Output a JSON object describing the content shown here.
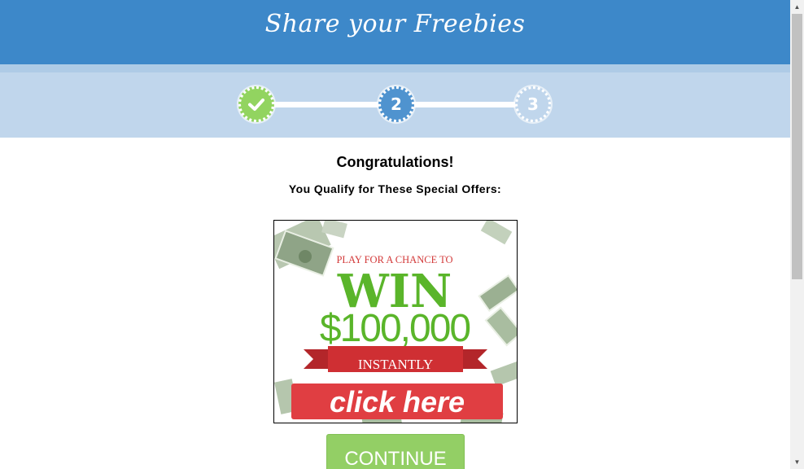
{
  "header": {
    "title": "Share your Freebies",
    "color": "#3d88c9"
  },
  "stepper": {
    "steps": [
      {
        "label": "",
        "state": "complete",
        "icon": "checkmark-icon",
        "color": "#92d460"
      },
      {
        "label": "2",
        "state": "current",
        "color": "#4f93cf"
      },
      {
        "label": "3",
        "state": "upcoming",
        "color": "#c0d6ec"
      }
    ]
  },
  "main": {
    "heading": "Congratulations!",
    "subheading": "You Qualify for These Special Offers:"
  },
  "ad": {
    "line1": "PLAY FOR A CHANCE TO",
    "line2": "WIN",
    "line3": "$100,000",
    "ribbon": "INSTANTLY",
    "cta": "click here",
    "icons": [
      "banknote-image"
    ]
  },
  "continue_label": "CONTINUE",
  "scrollbar": {
    "up_icon": "scroll-up-arrow-icon",
    "down_icon": "scroll-down-arrow-icon"
  }
}
